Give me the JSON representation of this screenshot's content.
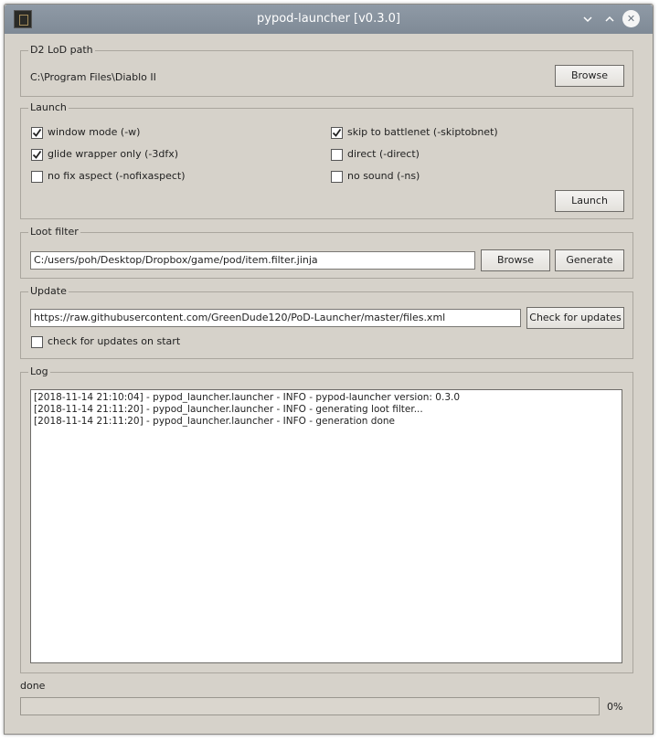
{
  "window": {
    "title": "pypod-launcher [v0.3.0]",
    "icons": {
      "minimize": "chevron-down-icon",
      "maximize": "chevron-up-icon",
      "close": "close-icon"
    }
  },
  "d2_path": {
    "label": "D2 LoD path",
    "value": "C:\\Program Files\\Diablo II",
    "browse_label": "Browse"
  },
  "launch": {
    "label": "Launch",
    "options": [
      {
        "label": "window mode (-w)",
        "checked": true
      },
      {
        "label": "glide wrapper only (-3dfx)",
        "checked": true
      },
      {
        "label": "no fix aspect (-nofixaspect)",
        "checked": false
      },
      {
        "label": "skip to battlenet (-skiptobnet)",
        "checked": true
      },
      {
        "label": "direct (-direct)",
        "checked": false
      },
      {
        "label": "no sound (-ns)",
        "checked": false
      }
    ],
    "launch_label": "Launch"
  },
  "loot_filter": {
    "label": "Loot filter",
    "value": "C:/users/poh/Desktop/Dropbox/game/pod/item.filter.jinja",
    "browse_label": "Browse",
    "generate_label": "Generate"
  },
  "update": {
    "label": "Update",
    "url": "https://raw.githubusercontent.com/GreenDude120/PoD-Launcher/master/files.xml",
    "check_label": "Check for updates",
    "on_start_label": "check for updates on start",
    "on_start_checked": false
  },
  "log": {
    "label": "Log",
    "lines": [
      "[2018-11-14 21:10:04] - pypod_launcher.launcher - INFO - pypod-launcher version: 0.3.0",
      "[2018-11-14 21:11:20] - pypod_launcher.launcher - INFO - generating loot filter...",
      "[2018-11-14 21:11:20] - pypod_launcher.launcher - INFO - generation done"
    ]
  },
  "status": {
    "text": "done",
    "progress_value": 0,
    "progress_label": "0%"
  }
}
